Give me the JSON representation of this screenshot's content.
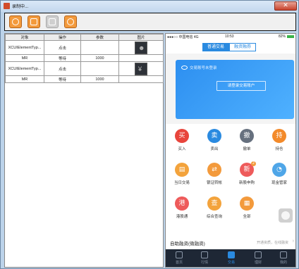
{
  "window": {
    "title": "录制中...",
    "close_glyph": "✕"
  },
  "toolbar": {
    "buttons": [
      {
        "name": "record-button",
        "icon": "record-icon"
      },
      {
        "name": "pause-button",
        "icon": "pause-icon"
      },
      {
        "name": "play-button",
        "icon": "play-icon"
      },
      {
        "name": "snapshot-button",
        "icon": "snapshot-icon"
      }
    ]
  },
  "table": {
    "headers": [
      "对象",
      "操作",
      "参数",
      "图片"
    ],
    "rows": [
      {
        "object": "XCUIElementTyp...",
        "action": "点击",
        "param": "",
        "image": "person"
      },
      {
        "object": "MR",
        "action": "等待",
        "param": "1000",
        "image": ""
      },
      {
        "object": "XCUIElementTyp...",
        "action": "点击",
        "param": "",
        "image": "yen"
      },
      {
        "object": "MR",
        "action": "等待",
        "param": "1000",
        "image": ""
      }
    ]
  },
  "phone": {
    "status": {
      "carrier": "●●●○○ 中国电信  4G",
      "time": "10:53",
      "battery": "82%"
    },
    "segment": {
      "tab1": "普通交易",
      "tab2": "融资融券"
    },
    "hero": {
      "hint": "交易账号未登录",
      "login": "请登录交易账户"
    },
    "grid": [
      {
        "label": "买入",
        "glyph": "买",
        "color": "#e8453c"
      },
      {
        "label": "卖出",
        "glyph": "卖",
        "color": "#2a8ae0"
      },
      {
        "label": "撤单",
        "glyph": "撤",
        "color": "#66707e"
      },
      {
        "label": "持仓",
        "glyph": "持",
        "color": "#f38a2a"
      },
      {
        "label": "当日交易",
        "glyph": "▤",
        "color": "#f3a33c"
      },
      {
        "label": "银证转帐",
        "glyph": "⇄",
        "color": "#f39a3c"
      },
      {
        "label": "新股申购",
        "glyph": "新",
        "color": "#ee5a5a",
        "badge": "2"
      },
      {
        "label": "现金管家",
        "glyph": "◔",
        "color": "#4fa6e8"
      },
      {
        "label": "港股通",
        "glyph": "港",
        "color": "#ee5a5a"
      },
      {
        "label": "综合查询",
        "glyph": "查",
        "color": "#f3a33c"
      },
      {
        "label": "全部",
        "glyph": "▦",
        "color": "#f39a3c"
      }
    ],
    "finance": {
      "title": "自助融资(微融资)",
      "subtitle": "开通资质，在线融资",
      "arrow": "›"
    },
    "tabs": [
      {
        "label": "首页",
        "active": false
      },
      {
        "label": "行情",
        "active": false
      },
      {
        "label": "交易",
        "active": true
      },
      {
        "label": "理财",
        "active": false
      },
      {
        "label": "我的",
        "active": false
      }
    ]
  }
}
